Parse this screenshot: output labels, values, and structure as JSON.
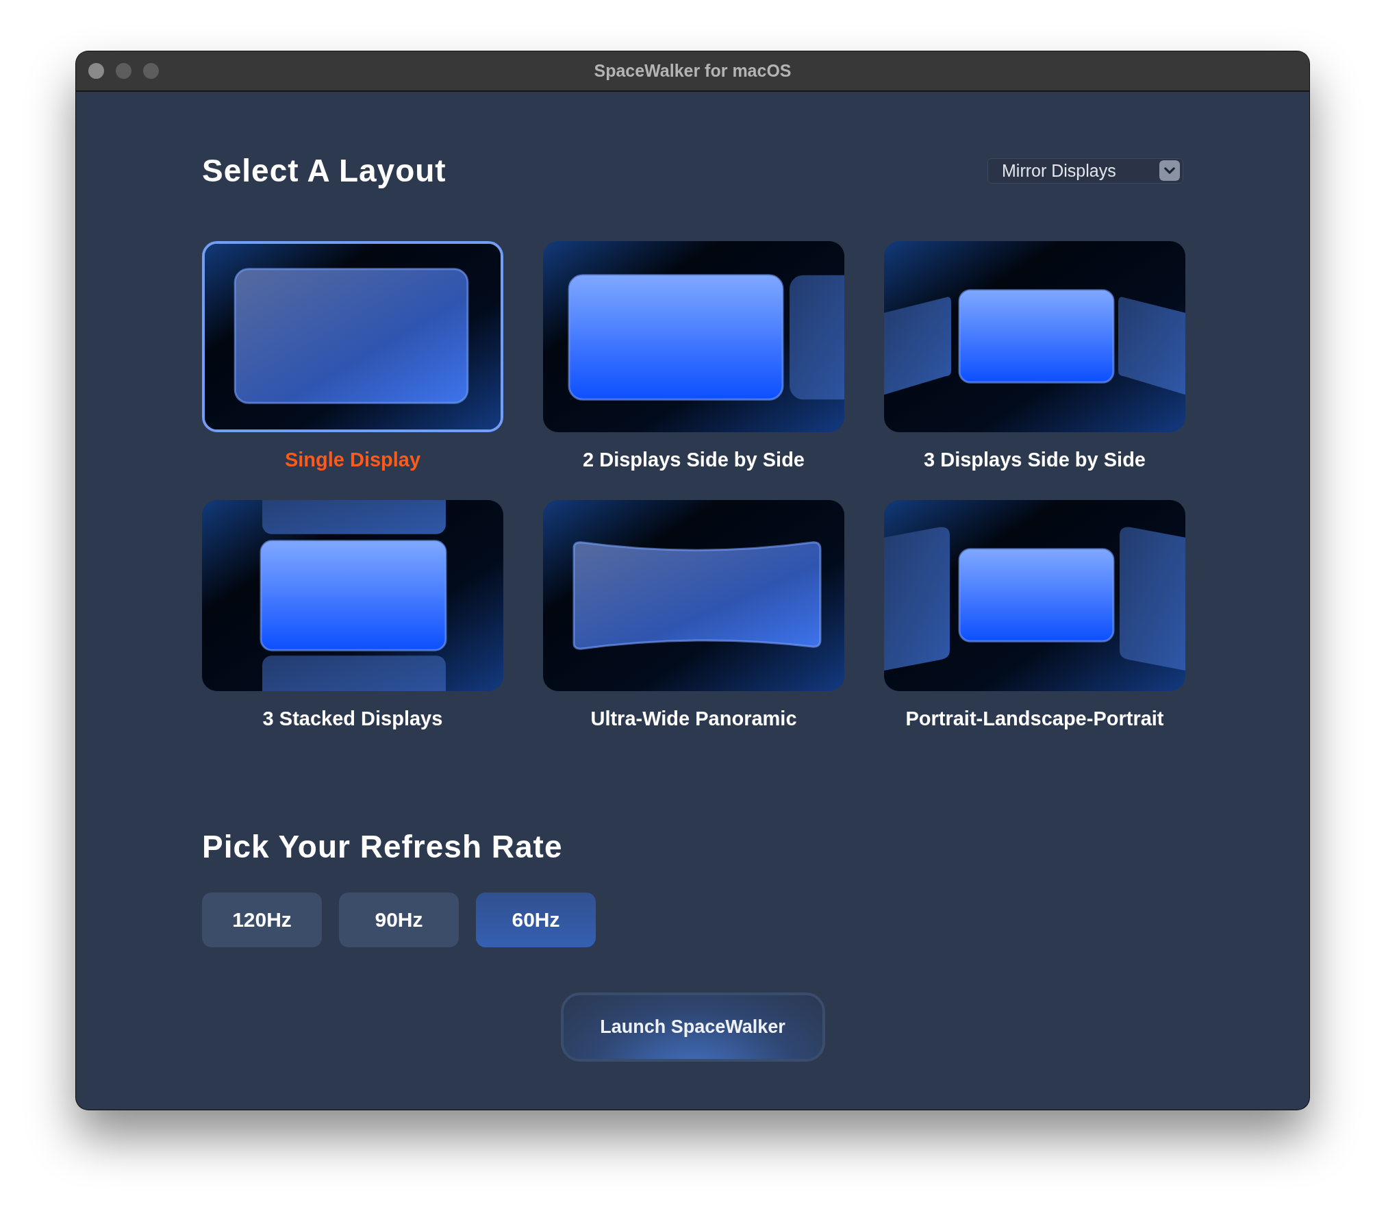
{
  "window": {
    "title": "SpaceWalker for macOS"
  },
  "layout_section": {
    "heading": "Select A Layout",
    "dropdown": {
      "value": "Mirror Displays"
    }
  },
  "layouts": [
    {
      "label": "Single Display",
      "kind": "single",
      "selected": true
    },
    {
      "label": "2 Displays Side by Side",
      "kind": "double",
      "selected": false
    },
    {
      "label": "3 Displays Side by Side",
      "kind": "triple",
      "selected": false
    },
    {
      "label": "3 Stacked Displays",
      "kind": "stacked",
      "selected": false
    },
    {
      "label": "Ultra-Wide Panoramic",
      "kind": "panoramic",
      "selected": false
    },
    {
      "label": "Portrait-Landscape-Portrait",
      "kind": "plp",
      "selected": false
    }
  ],
  "refresh_section": {
    "heading": "Pick Your Refresh Rate"
  },
  "refresh_rates": [
    {
      "label": "120Hz",
      "selected": false
    },
    {
      "label": "90Hz",
      "selected": false
    },
    {
      "label": "60Hz",
      "selected": true
    }
  ],
  "launch_button": {
    "label": "Launch SpaceWalker"
  }
}
